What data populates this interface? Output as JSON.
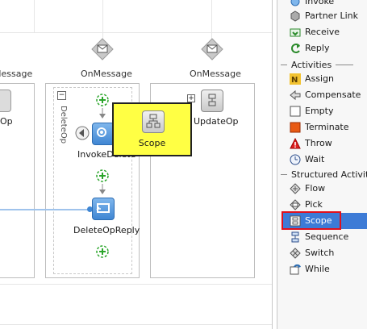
{
  "canvas": {
    "branches": [
      {
        "label": "OnMessage",
        "activity": "Op"
      },
      {
        "label": "OnMessage",
        "activity": "DeleteOp"
      },
      {
        "label": "OnMessage",
        "activity": "UpdateOp"
      }
    ],
    "left_partial_label": "Message",
    "delete_branch": {
      "scope_vertical_label": "DeleteOp",
      "collapse_symbol": "−",
      "invoke_label": "InvokeDelete",
      "reply_label": "DeleteOpReply"
    },
    "update_branch": {
      "expand_symbol": "+"
    },
    "popup": {
      "label": "Scope"
    }
  },
  "palette": {
    "top_items": [
      {
        "label": "Invoke",
        "icon": "invoke-icon"
      },
      {
        "label": "Partner Link",
        "icon": "partner-link-icon"
      },
      {
        "label": "Receive",
        "icon": "receive-icon"
      },
      {
        "label": "Reply",
        "icon": "reply-icon"
      }
    ],
    "activities_header": "Activities",
    "activities": [
      {
        "label": "Assign",
        "icon": "assign-icon"
      },
      {
        "label": "Compensate",
        "icon": "compensate-icon"
      },
      {
        "label": "Empty",
        "icon": "empty-icon"
      },
      {
        "label": "Terminate",
        "icon": "terminate-icon"
      },
      {
        "label": "Throw",
        "icon": "throw-icon"
      },
      {
        "label": "Wait",
        "icon": "wait-icon"
      }
    ],
    "structured_header": "Structured Activiti",
    "structured": [
      {
        "label": "Flow",
        "icon": "flow-icon"
      },
      {
        "label": "Pick",
        "icon": "pick-icon"
      },
      {
        "label": "Scope",
        "icon": "scope-icon",
        "selected": true
      },
      {
        "label": "Sequence",
        "icon": "sequence-icon"
      },
      {
        "label": "Switch",
        "icon": "switch-icon"
      },
      {
        "label": "While",
        "icon": "while-icon"
      }
    ],
    "colors": {
      "selection": "#3d7bd6",
      "highlight_border": "#e0101c",
      "popup_fill": "#ffff44"
    }
  }
}
